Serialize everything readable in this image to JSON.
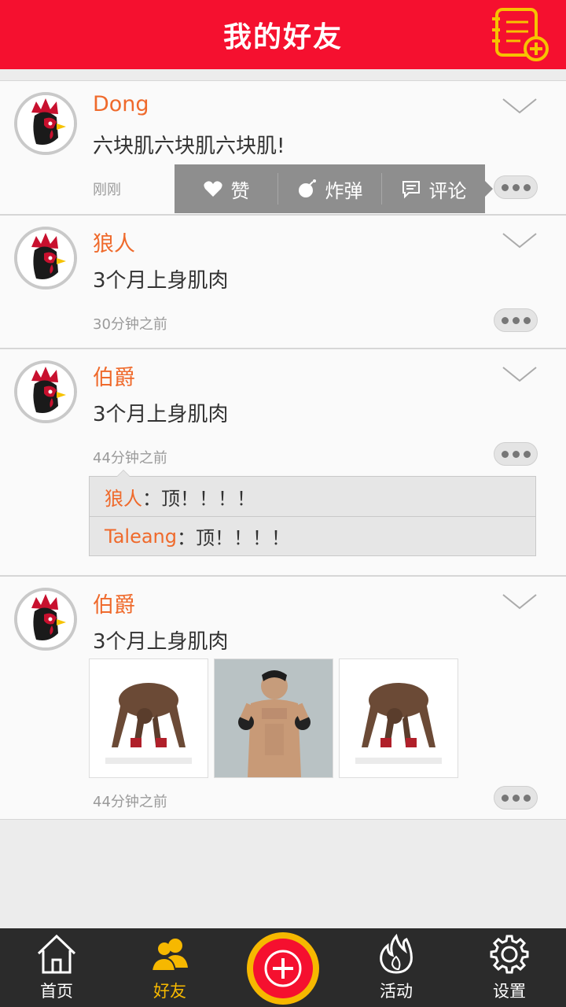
{
  "header": {
    "title": "我的好友",
    "compose_icon": "compose-add-icon"
  },
  "colors": {
    "header": "#f5102f",
    "name": "#ef6a2c",
    "tab_active": "#f6b800",
    "tabbar": "#2b2b2b"
  },
  "posts": [
    {
      "author": "Dong",
      "content": "六块肌六块肌六块肌!",
      "time": "刚刚"
    },
    {
      "author": "狼人",
      "content": "3个月上身肌肉",
      "time": "30分钟之前"
    },
    {
      "author": "伯爵",
      "content": "3个月上身肌肉",
      "time": "44分钟之前",
      "comments": [
        {
          "author": "狼人",
          "text": "：顶！！！！"
        },
        {
          "author": "Taleang",
          "text": "：顶！！！！"
        }
      ]
    },
    {
      "author": "伯爵",
      "content": "3个月上身肌肉",
      "time": "44分钟之前"
    }
  ],
  "actions": {
    "like": "赞",
    "bomb": "炸弹",
    "comment": "评论"
  },
  "tabs": [
    {
      "label": "首页",
      "icon": "home-icon"
    },
    {
      "label": "好友",
      "icon": "friends-icon"
    },
    {
      "label": "",
      "icon": "add-circle-icon"
    },
    {
      "label": "活动",
      "icon": "flame-icon"
    },
    {
      "label": "设置",
      "icon": "gear-icon"
    }
  ]
}
